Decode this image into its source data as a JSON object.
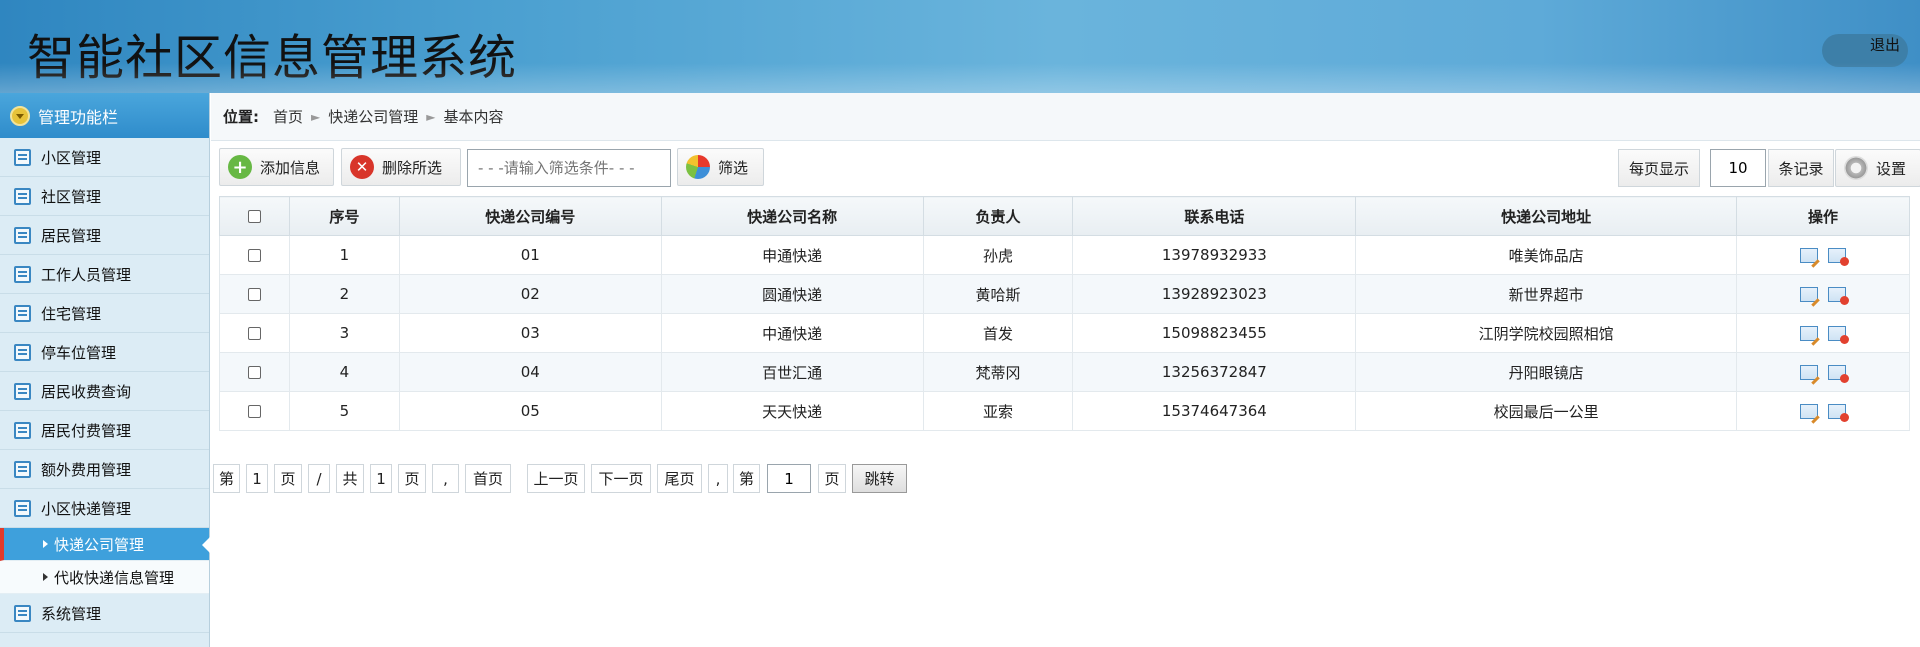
{
  "header": {
    "title": "智能社区信息管理系统",
    "logout_label": "退出"
  },
  "sidebar": {
    "heading": "管理功能栏",
    "items": [
      {
        "label": "小区管理"
      },
      {
        "label": "社区管理"
      },
      {
        "label": "居民管理"
      },
      {
        "label": "工作人员管理"
      },
      {
        "label": "住宅管理"
      },
      {
        "label": "停车位管理"
      },
      {
        "label": "居民收费查询"
      },
      {
        "label": "居民付费管理"
      },
      {
        "label": "额外费用管理"
      },
      {
        "label": "小区快递管理"
      }
    ],
    "sub_items": [
      {
        "label": "快递公司管理",
        "active": true
      },
      {
        "label": "代收快递信息管理",
        "active": false
      }
    ],
    "last_item": {
      "label": "系统管理"
    }
  },
  "breadcrumb": {
    "prefix": "位置:",
    "items": [
      "首页",
      "快递公司管理",
      "基本内容"
    ]
  },
  "toolbar": {
    "add_label": "添加信息",
    "delete_label": "删除所选",
    "filter_placeholder": "- - -请输入筛选条件- - -",
    "filter_label": "筛选",
    "per_page_prefix": "每页显示",
    "per_page_value": "10",
    "per_page_suffix": "条记录",
    "settings_label": "设置"
  },
  "table": {
    "headers": [
      "序号",
      "快递公司编号",
      "快递公司名称",
      "负责人",
      "联系电话",
      "快递公司地址",
      "操作"
    ],
    "rows": [
      [
        "1",
        "01",
        "申通快递",
        "孙虎",
        "13978932933",
        "唯美饰品店"
      ],
      [
        "2",
        "02",
        "圆通快递",
        "黄哈斯",
        "13928923023",
        "新世界超市"
      ],
      [
        "3",
        "03",
        "中通快递",
        "首发",
        "15098823455",
        "江阴学院校园照相馆"
      ],
      [
        "4",
        "04",
        "百世汇通",
        "梵蒂冈",
        "13256372847",
        "丹阳眼镜店"
      ],
      [
        "5",
        "05",
        "天天快递",
        "亚索",
        "15374647364",
        "校园最后一公里"
      ]
    ]
  },
  "pager": {
    "di": "第",
    "current": "1",
    "ye": "页",
    "slash": "/",
    "gong": "共",
    "total": "1",
    "ye2": "页",
    "comma": ",",
    "first": "首页",
    "prev": "上一页",
    "next": "下一页",
    "last": "尾页",
    "comma2": ",",
    "di2": "第",
    "goto_value": "1",
    "ye3": "页",
    "jump": "跳转"
  }
}
